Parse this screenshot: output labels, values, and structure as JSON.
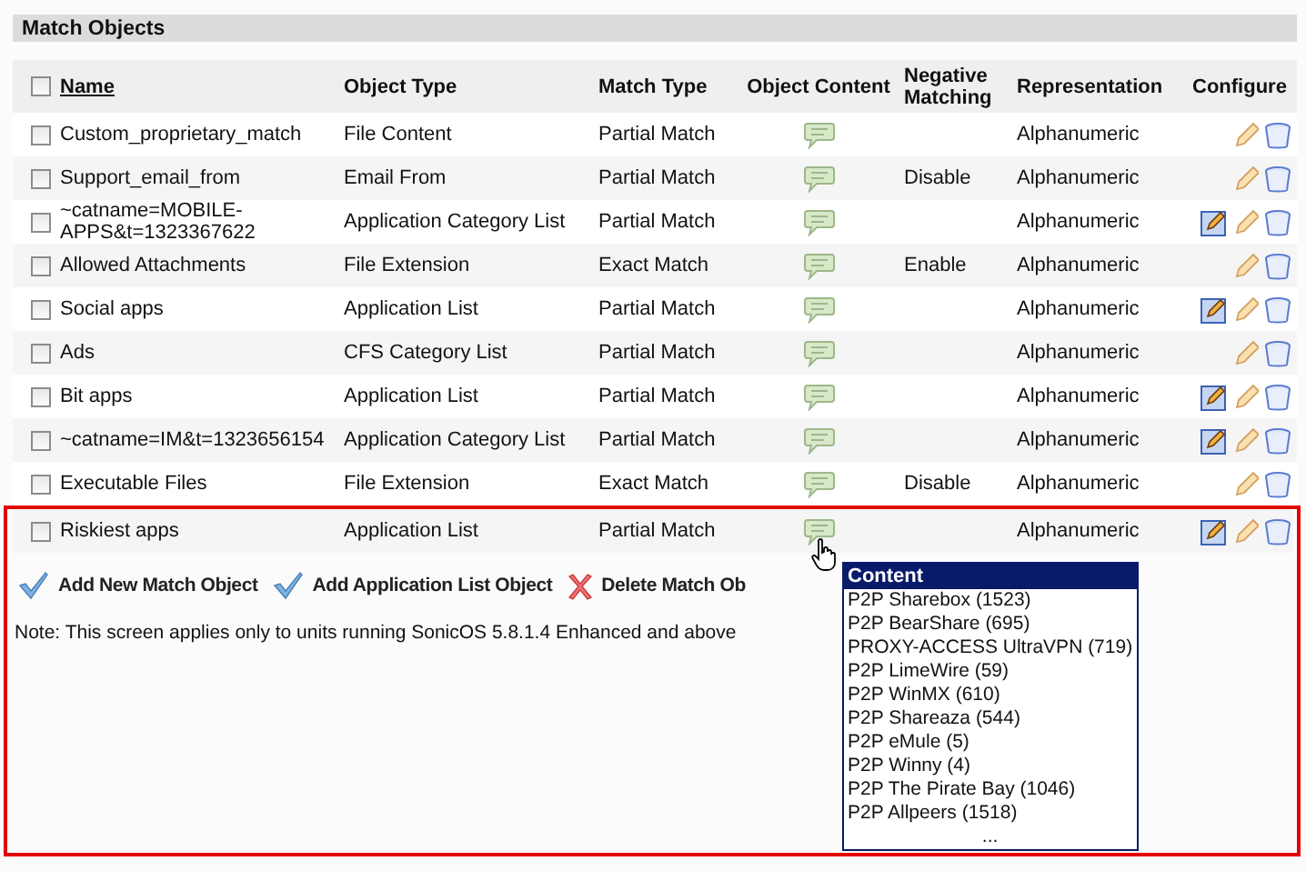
{
  "panel": {
    "title": "Match Objects"
  },
  "table": {
    "columns": [
      {
        "label": "Name",
        "sortable": true
      },
      {
        "label": "Object Type",
        "sortable": false
      },
      {
        "label": "Match Type",
        "sortable": false
      },
      {
        "label": "Object Content",
        "sortable": false
      },
      {
        "label": "Negative Matching",
        "sortable": false
      },
      {
        "label": "Representation",
        "sortable": false
      },
      {
        "label": "Configure",
        "sortable": false
      }
    ],
    "select_all": {
      "checked": false
    },
    "rows": [
      {
        "name": "Custom_proprietary_match",
        "object_type": "File Content",
        "match_type": "Partial Match",
        "negative_matching": "",
        "representation": "Alphanumeric",
        "checked": false,
        "list_edit": false
      },
      {
        "name": "Support_email_from",
        "object_type": "Email From",
        "match_type": "Partial Match",
        "negative_matching": "Disable",
        "representation": "Alphanumeric",
        "checked": false,
        "list_edit": false
      },
      {
        "name": "~catname=MOBILE-APPS&t=1323367622",
        "object_type": "Application Category List",
        "match_type": "Partial Match",
        "negative_matching": "",
        "representation": "Alphanumeric",
        "checked": false,
        "list_edit": true
      },
      {
        "name": "Allowed Attachments",
        "object_type": "File Extension",
        "match_type": "Exact Match",
        "negative_matching": "Enable",
        "representation": "Alphanumeric",
        "checked": false,
        "list_edit": false
      },
      {
        "name": "Social apps",
        "object_type": "Application List",
        "match_type": "Partial Match",
        "negative_matching": "",
        "representation": "Alphanumeric",
        "checked": false,
        "list_edit": true
      },
      {
        "name": "Ads",
        "object_type": "CFS Category List",
        "match_type": "Partial Match",
        "negative_matching": "",
        "representation": "Alphanumeric",
        "checked": false,
        "list_edit": false
      },
      {
        "name": "Bit apps",
        "object_type": "Application List",
        "match_type": "Partial Match",
        "negative_matching": "",
        "representation": "Alphanumeric",
        "checked": false,
        "list_edit": true
      },
      {
        "name": "~catname=IM&t=1323656154",
        "object_type": "Application Category List",
        "match_type": "Partial Match",
        "negative_matching": "",
        "representation": "Alphanumeric",
        "checked": false,
        "list_edit": true
      },
      {
        "name": "Executable Files",
        "object_type": "File Extension",
        "match_type": "Exact Match",
        "negative_matching": "Disable",
        "representation": "Alphanumeric",
        "checked": false,
        "list_edit": false
      }
    ]
  },
  "highlight_box": {
    "rows": [
      {
        "name": "Riskiest apps",
        "object_type": "Application List",
        "match_type": "Partial Match",
        "negative_matching": "",
        "representation": "Alphanumeric",
        "checked": false,
        "list_edit": true,
        "hovered": true,
        "content_popup": {
          "title": "Content",
          "items": [
            "P2P Sharebox (1523)",
            "P2P BearShare (695)",
            "PROXY-ACCESS UltraVPN (719)",
            "P2P LimeWire (59)",
            "P2P WinMX (610)",
            "P2P Shareaza (544)",
            "P2P eMule (5)",
            "P2P Winny (4)",
            "P2P The Pirate Bay (1046)",
            "P2P Allpeers (1518)",
            "..."
          ]
        }
      }
    ],
    "actions": [
      {
        "label": "Add New Match Object",
        "kind": "add"
      },
      {
        "label": "Add Application List Object",
        "kind": "add"
      },
      {
        "label": "Delete Match Ob",
        "kind": "delete"
      }
    ],
    "note": "Note: This screen applies only to units running SonicOS 5.8.1.4 Enhanced and above"
  }
}
